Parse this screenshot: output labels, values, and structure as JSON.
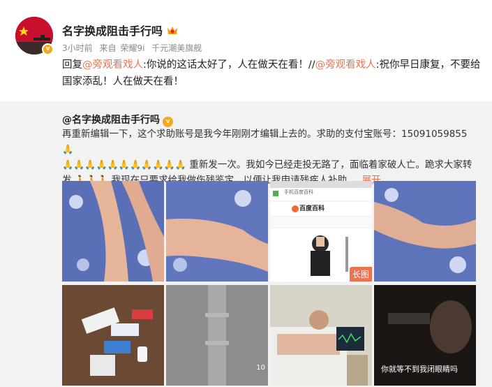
{
  "post": {
    "username": "名字换成阻击手行吗",
    "time": "3小时前",
    "source_prefix": "来自",
    "source_device": "荣耀9i",
    "source_extra": "千元潮美旗舰",
    "reply_prefix": "回复",
    "mention_1": "@旁观看戏人",
    "reply_quote": ":你说的这话太好了，人在做天在看！//",
    "mention_2": "@旁观看戏人",
    "reply_rest": ":祝你早日康复，不要给国家添乱！人在做天在看！"
  },
  "original": {
    "username": "@名字换成阻击手行吗",
    "text_1": "再重新编辑一下，这个求助账号是我今年刚刚才编辑上去的。求助的支付宝账号：15091059855",
    "text_2": "重新发一次。我如今已经走投无路了，面临着家破人亡。跪求大家转发",
    "text_3": "我现在只要求给我做伤残鉴定，以便让我申请残疾人补助",
    "ellipsis": "...",
    "expand_label": "展开",
    "emoji_clap": "🙏",
    "emoji_pray": "🙏"
  },
  "images": {
    "long_badge": "长图",
    "baike_title": "百度百科",
    "baike_url": "手机百度百科",
    "caption_8": "你就等不到我闭眼睛吗",
    "num_6": "10"
  },
  "colors": {
    "accent": "#eb7350",
    "vip": "#f5a623",
    "repost_bg": "#f2f2f2"
  }
}
